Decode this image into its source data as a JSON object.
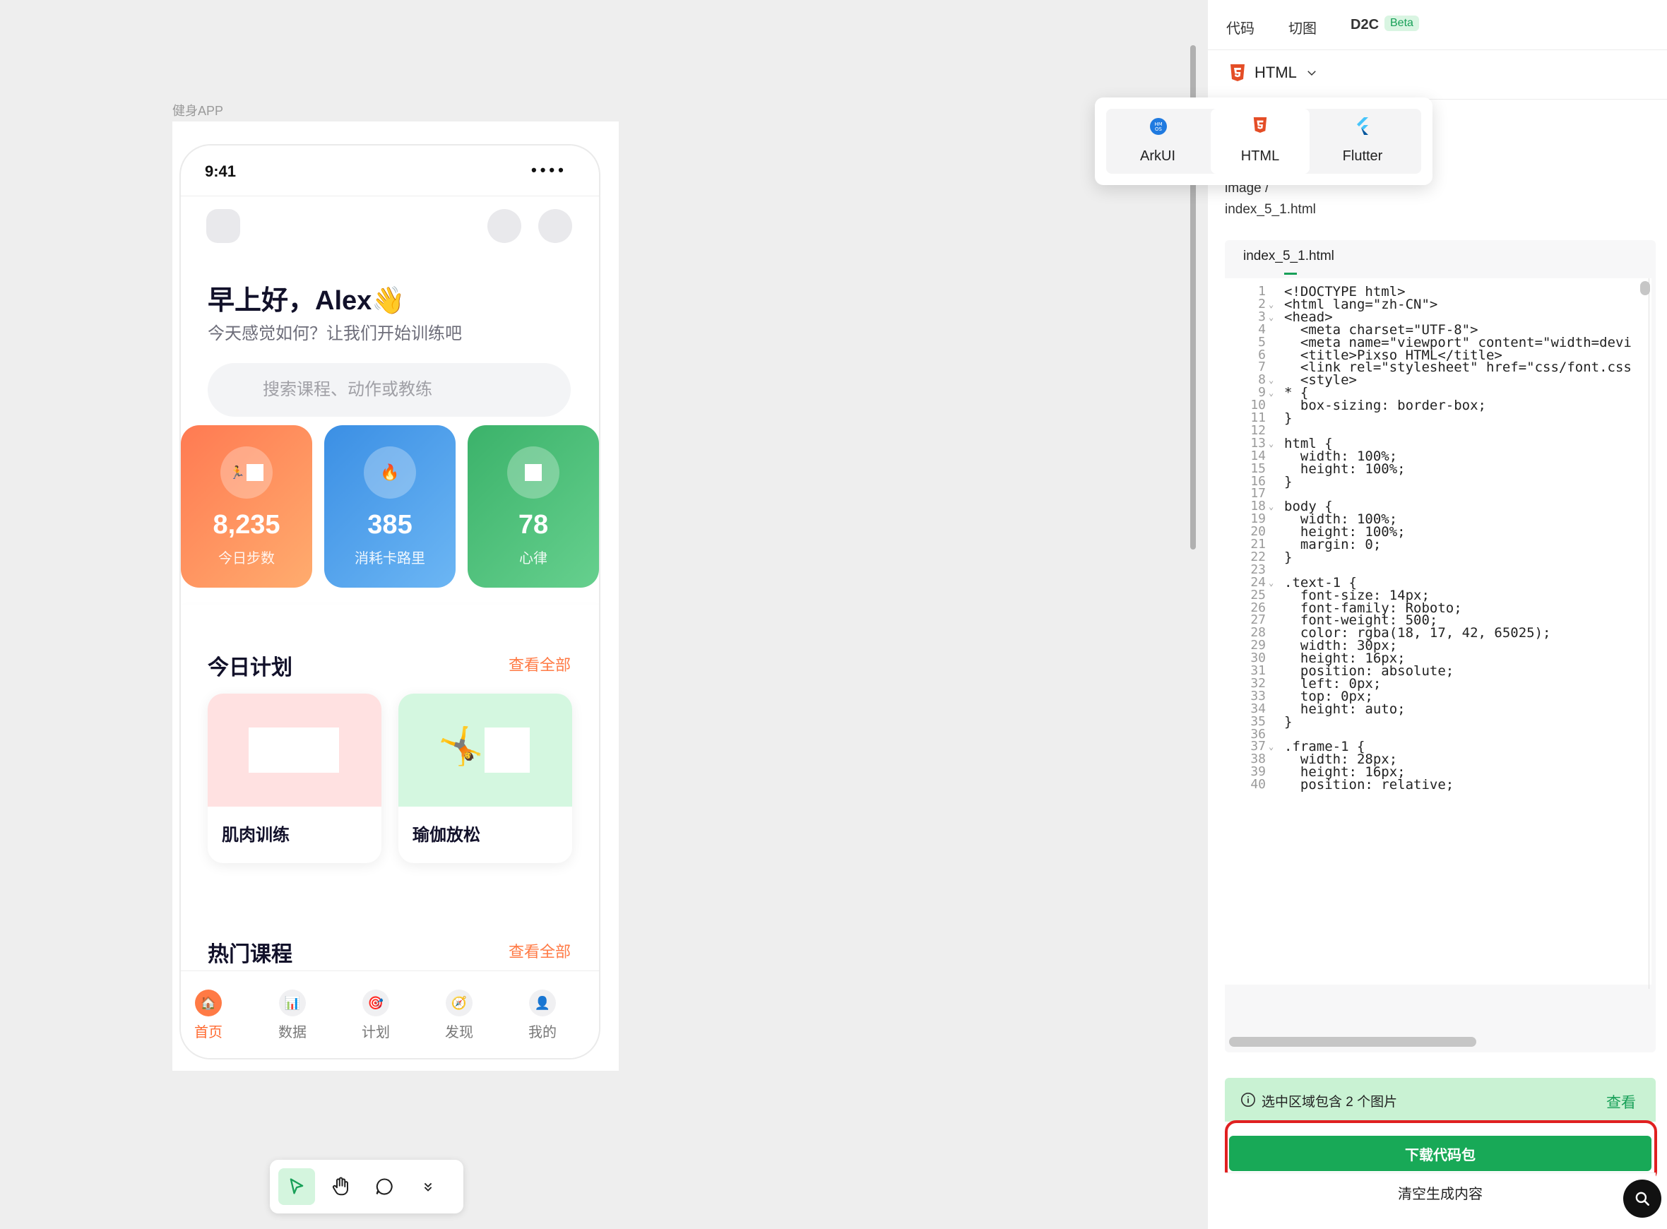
{
  "canvas": {
    "frame_label": "健身APP"
  },
  "app": {
    "status_time": "9:41",
    "status_dots": "••••",
    "greeting": "早上好，Alex👋",
    "subtitle": "今天感觉如何？让我们开始训练吧",
    "search_placeholder": "搜索课程、动作或教练",
    "stats": [
      {
        "value": "8,235",
        "label": "今日步数",
        "icon": "🏃",
        "color_from": "#ff7a52",
        "color_to": "#ffac6e"
      },
      {
        "value": "385",
        "label": "消耗卡路里",
        "icon": "🔥",
        "color_from": "#3b8fe4",
        "color_to": "#6cb6f4"
      },
      {
        "value": "78",
        "label": "心律",
        "icon": "",
        "color_from": "#3bb26a",
        "color_to": "#66d08e"
      }
    ],
    "today_plan": {
      "title": "今日计划",
      "see_all": "查看全部",
      "cards": [
        {
          "name": "肌肉训练",
          "bg": "#ffe1e1"
        },
        {
          "name": "瑜伽放松",
          "bg": "#d4f7e0",
          "icon": "🤸"
        }
      ]
    },
    "hot_courses": {
      "title": "热门课程",
      "see_all": "查看全部"
    },
    "nav": [
      {
        "label": "首页",
        "icon": "🏠",
        "active": true
      },
      {
        "label": "数据",
        "icon": "📊"
      },
      {
        "label": "计划",
        "icon": "🎯"
      },
      {
        "label": "发现",
        "icon": "🧭"
      },
      {
        "label": "我的",
        "icon": "👤"
      }
    ]
  },
  "panel": {
    "tabs": [
      "代码",
      "切图",
      "D2C"
    ],
    "beta": "Beta",
    "language": "HTML",
    "path_line1": "image /",
    "path_line2": "index_5_1.html",
    "file_tab": "index_5_1.html",
    "dropdown_options": [
      "ArkUI",
      "HTML",
      "Flutter"
    ],
    "notice": "选中区域包含 2 个图片",
    "notice_link": "查看",
    "download": "下载代码包",
    "clear": "清空生成内容",
    "code_lines": [
      "<!DOCTYPE html>",
      "<html lang=\"zh-CN\">",
      "<head>",
      "  <meta charset=\"UTF-8\">",
      "  <meta name=\"viewport\" content=\"width=devi",
      "  <title>Pixso HTML</title>",
      "  <link rel=\"stylesheet\" href=\"css/font.css",
      "  <style>",
      "* {",
      "  box-sizing: border-box;",
      "}",
      "",
      "html {",
      "  width: 100%;",
      "  height: 100%;",
      "}",
      "",
      "body {",
      "  width: 100%;",
      "  height: 100%;",
      "  margin: 0;",
      "}",
      "",
      ".text-1 {",
      "  font-size: 14px;",
      "  font-family: Roboto;",
      "  font-weight: 500;",
      "  color: rgba(18, 17, 42, 65025);",
      "  width: 30px;",
      "  height: 16px;",
      "  position: absolute;",
      "  left: 0px;",
      "  top: 0px;",
      "  height: auto;",
      "}",
      "",
      ".frame-1 {",
      "  width: 28px;",
      "  height: 16px;",
      "  position: relative;"
    ],
    "fold_lines": [
      2,
      3,
      8,
      9,
      13,
      18,
      24,
      37
    ]
  }
}
